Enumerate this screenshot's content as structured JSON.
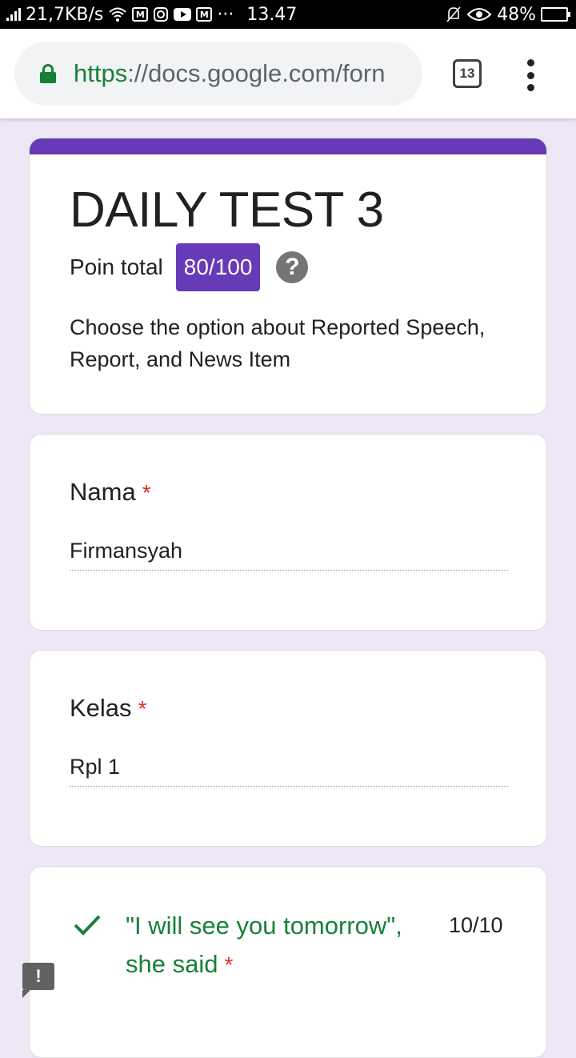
{
  "status_bar": {
    "net_speed": "21,7KB/s",
    "time": "13.47",
    "battery": "48%",
    "battery_level": 0.48
  },
  "browser": {
    "url_scheme": "https",
    "url_sep": "://",
    "url_rest": "docs.google.com/forn",
    "tab_count": "13"
  },
  "colors": {
    "accent": "#673ab7",
    "background": "#ede7f6",
    "correct_green": "#188038",
    "required_red": "#d93025"
  },
  "form": {
    "title": "DAILY TEST 3",
    "points_label": "Poin total",
    "points_value": "80/100",
    "help_symbol": "?",
    "description": "Choose the option about Reported Speech, Report, and News Item"
  },
  "questions": [
    {
      "title": "Nama",
      "required_mark": "*",
      "answer": "Firmansyah"
    },
    {
      "title": "Kelas",
      "required_mark": "*",
      "answer": "Rpl 1"
    },
    {
      "title": "\"I will see you tomorrow\", she said",
      "required_mark": "*",
      "score": "10/10",
      "status_icon": "check-icon"
    }
  ],
  "feedback": {
    "symbol": "!"
  }
}
